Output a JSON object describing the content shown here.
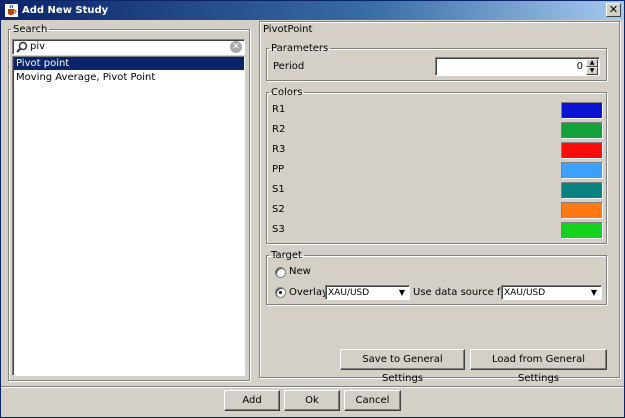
{
  "window": {
    "title": "Add New Study",
    "close_label": "✕"
  },
  "search": {
    "legend": "Search",
    "value": "piv",
    "clear_label": "✕"
  },
  "list": {
    "items": [
      {
        "label": "Pivot point",
        "selected": true
      },
      {
        "label": "Moving Average, Pivot Point",
        "selected": false
      }
    ]
  },
  "panel": {
    "title": "PivotPoint"
  },
  "parameters": {
    "legend": "Parameters",
    "period_label": "Period",
    "period_value": "0"
  },
  "colors": {
    "legend": "Colors",
    "items": [
      {
        "label": "R1",
        "color": "#0a14d2"
      },
      {
        "label": "R2",
        "color": "#13a33a"
      },
      {
        "label": "R3",
        "color": "#ff0a0a"
      },
      {
        "label": "PP",
        "color": "#3ca0ff"
      },
      {
        "label": "S1",
        "color": "#0a8282"
      },
      {
        "label": "S2",
        "color": "#ff7814"
      },
      {
        "label": "S3",
        "color": "#14d21e"
      }
    ]
  },
  "target": {
    "legend": "Target",
    "new_label": "New",
    "overlay_label": "Overlay",
    "selected": "overlay",
    "instrument": "XAU/USD",
    "data_source_label": "Use data source from",
    "data_source": "XAU/USD"
  },
  "buttons": {
    "save_general": "Save to General Settings",
    "load_general": "Load from General Settings",
    "add": "Add",
    "ok": "Ok",
    "cancel": "Cancel"
  }
}
